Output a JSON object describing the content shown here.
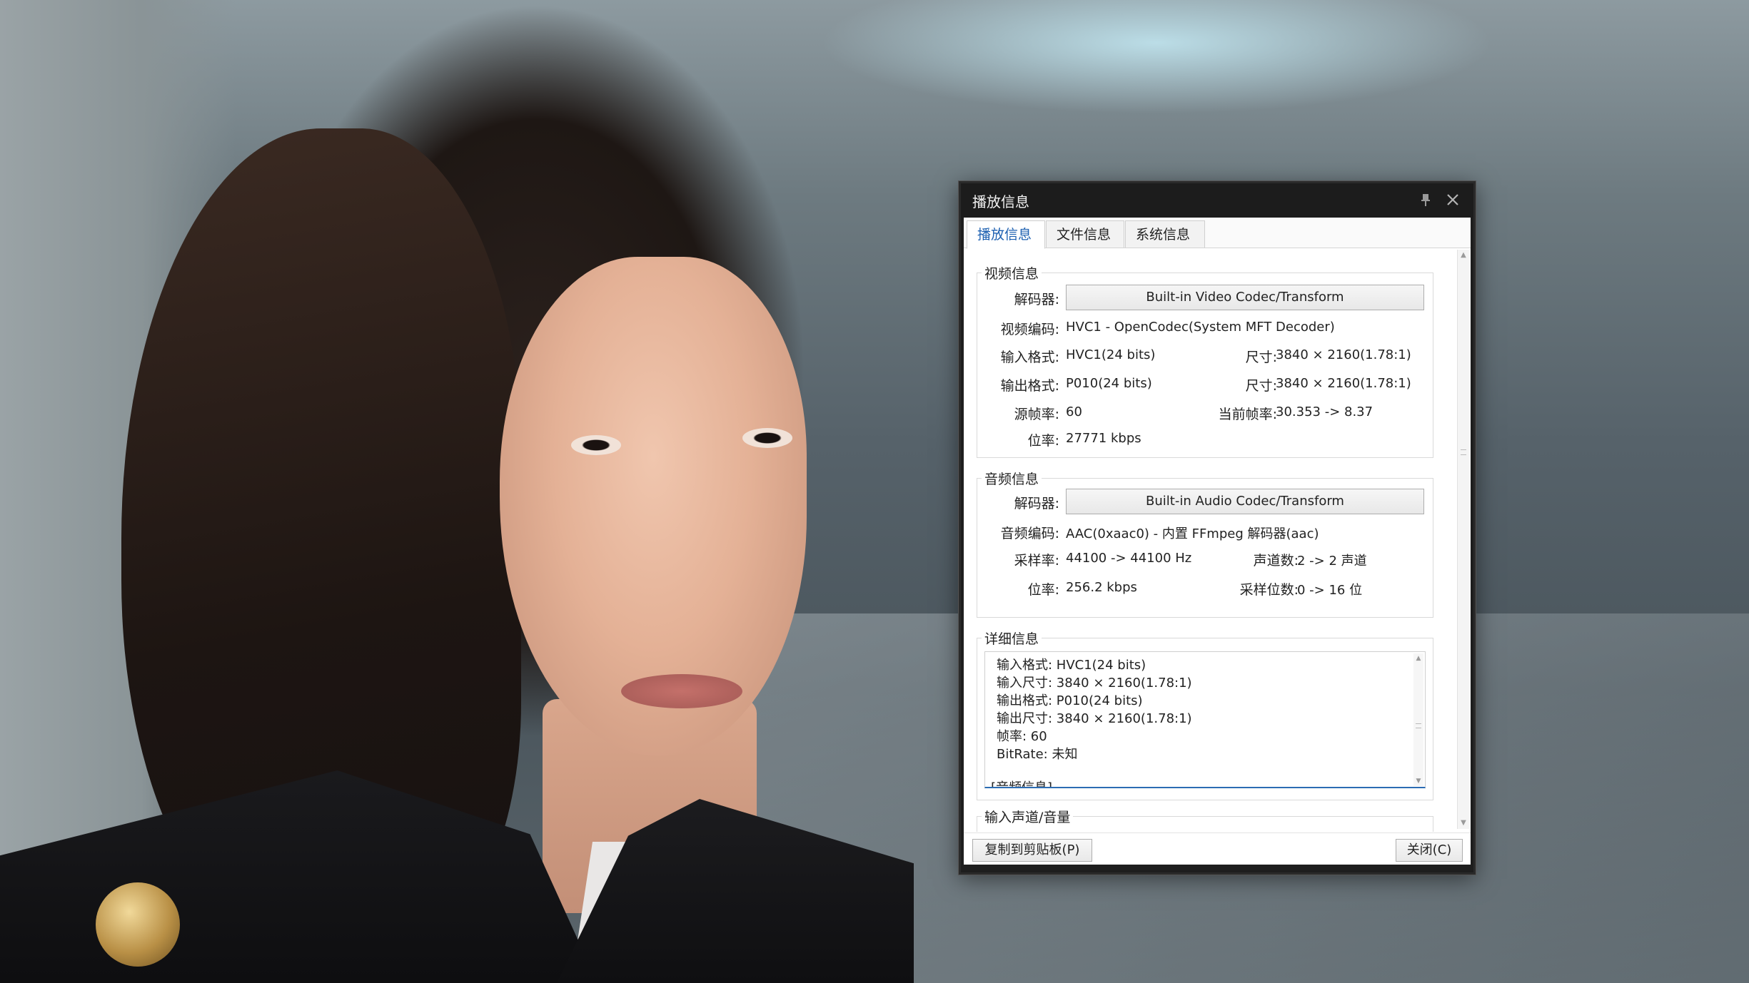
{
  "dialog": {
    "title": "播放信息",
    "pin_icon": "pin-icon",
    "close_icon": "close-icon"
  },
  "tabs": [
    {
      "label": "播放信息",
      "active": true
    },
    {
      "label": "文件信息",
      "active": false
    },
    {
      "label": "系统信息",
      "active": false
    }
  ],
  "video": {
    "group_title": "视频信息",
    "decoder_label": "解码器:",
    "decoder_button": "Built-in Video Codec/Transform",
    "codec_label": "视频编码:",
    "codec_value": "HVC1 - OpenCodec(System MFT Decoder)",
    "input_format_label": "输入格式:",
    "input_format_value": "HVC1(24 bits)",
    "input_size_label": "尺寸:",
    "input_size_value": "3840 × 2160(1.78:1)",
    "output_format_label": "输出格式:",
    "output_format_value": "P010(24 bits)",
    "output_size_label": "尺寸:",
    "output_size_value": "3840 × 2160(1.78:1)",
    "source_fps_label": "源帧率:",
    "source_fps_value": "60",
    "current_fps_label": "当前帧率:",
    "current_fps_value": "30.353 -> 8.37",
    "bitrate_label": "位率:",
    "bitrate_value": "27771 kbps"
  },
  "audio": {
    "group_title": "音频信息",
    "decoder_label": "解码器:",
    "decoder_button": "Built-in Audio Codec/Transform",
    "codec_label": "音频编码:",
    "codec_value": "AAC(0xaac0) - 内置 FFmpeg 解码器(aac)",
    "sample_rate_label": "采样率:",
    "sample_rate_value": "44100 -> 44100 Hz",
    "channels_label": "声道数:",
    "channels_value": "2 -> 2 声道",
    "bitrate_label": "位率:",
    "bitrate_value": "256.2 kbps",
    "sample_bits_label": "采样位数:",
    "sample_bits_value": "0 -> 16 位"
  },
  "details": {
    "group_title": "详细信息",
    "lines": [
      "输入格式:   HVC1(24 bits)",
      "输入尺寸:   3840 × 2160(1.78:1)",
      "输出格式:   P010(24 bits)",
      "输出尺寸:   3840 × 2160(1.78:1)",
      "帧率:   60",
      "BitRate: 未知",
      "",
      "[音频信息]"
    ]
  },
  "volume": {
    "group_title": "输入声道/音量"
  },
  "footer": {
    "copy_button": "复制到剪贴板(P)",
    "close_button": "关闭(C)"
  }
}
